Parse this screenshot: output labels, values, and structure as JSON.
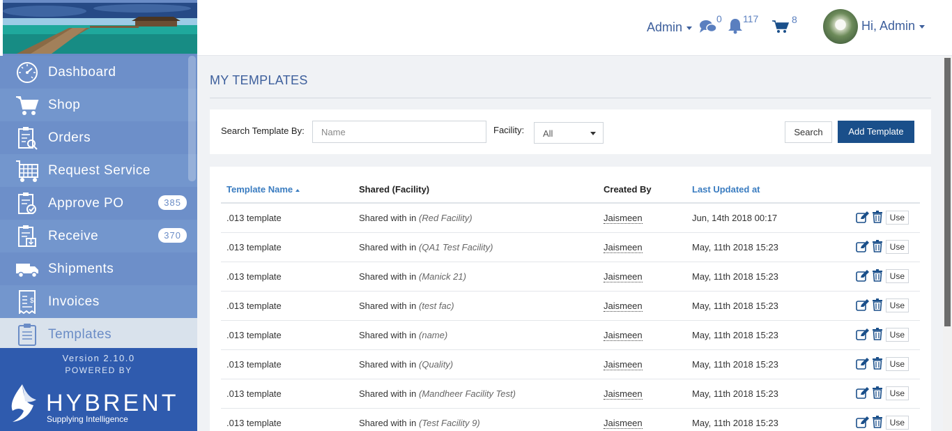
{
  "header": {
    "admin_menu": "Admin",
    "messages_count": "0",
    "notifications_count": "117",
    "cart_count": "8",
    "greeting": "Hi, Admin"
  },
  "sidebar": {
    "items": [
      {
        "label": "Dashboard",
        "icon": "dashboard-icon"
      },
      {
        "label": "Shop",
        "icon": "cart-icon"
      },
      {
        "label": "Orders",
        "icon": "orders-icon"
      },
      {
        "label": "Request Service",
        "icon": "service-icon"
      },
      {
        "label": "Approve PO",
        "icon": "approve-icon",
        "badge": "385"
      },
      {
        "label": "Receive",
        "icon": "receive-icon",
        "badge": "370"
      },
      {
        "label": "Shipments",
        "icon": "truck-icon"
      },
      {
        "label": "Invoices",
        "icon": "invoice-icon"
      },
      {
        "label": "Templates",
        "icon": "templates-icon",
        "active": true
      }
    ],
    "version": "Version 2.10.0",
    "powered_by": "POWERED BY",
    "logo_name": "HYBRENT",
    "logo_tagline": "Supplying Intelligence"
  },
  "main": {
    "title": "MY TEMPLATES",
    "search_label": "Search Template By:",
    "search_placeholder": "Name",
    "facility_label": "Facility:",
    "facility_value": "All",
    "search_button": "Search",
    "add_button": "Add Template"
  },
  "table": {
    "headers": {
      "name": "Template Name",
      "shared": "Shared (Facility)",
      "created_by": "Created By",
      "updated": "Last Updated at"
    },
    "shared_prefix": "Shared with in",
    "use_label": "Use",
    "rows": [
      {
        "name": ".013 template",
        "facility": "(Red Facility)",
        "created_by": "Jaismeen",
        "updated": "Jun, 14th 2018 00:17"
      },
      {
        "name": ".013 template",
        "facility": "(QA1 Test Facility)",
        "created_by": "Jaismeen",
        "updated": "May, 11th 2018 15:23"
      },
      {
        "name": ".013 template",
        "facility": "(Manick 21)",
        "created_by": "Jaismeen",
        "updated": "May, 11th 2018 15:23"
      },
      {
        "name": ".013 template",
        "facility": "(test fac)",
        "created_by": "Jaismeen",
        "updated": "May, 11th 2018 15:23"
      },
      {
        "name": ".013 template",
        "facility": "(name)",
        "created_by": "Jaismeen",
        "updated": "May, 11th 2018 15:23"
      },
      {
        "name": ".013 template",
        "facility": "(Quality)",
        "created_by": "Jaismeen",
        "updated": "May, 11th 2018 15:23"
      },
      {
        "name": ".013 template",
        "facility": "(Mandheer Facility Test)",
        "created_by": "Jaismeen",
        "updated": "May, 11th 2018 15:23"
      },
      {
        "name": ".013 template",
        "facility": "(Test Facility 9)",
        "created_by": "Jaismeen",
        "updated": "May, 11th 2018 15:23"
      }
    ]
  },
  "colors": {
    "sidebar": "#6a8cc6",
    "sidebar_footer": "#2f5bae",
    "primary_button": "#1a4f8a",
    "link": "#3a7cc0",
    "header_text": "#3d5f9c"
  }
}
